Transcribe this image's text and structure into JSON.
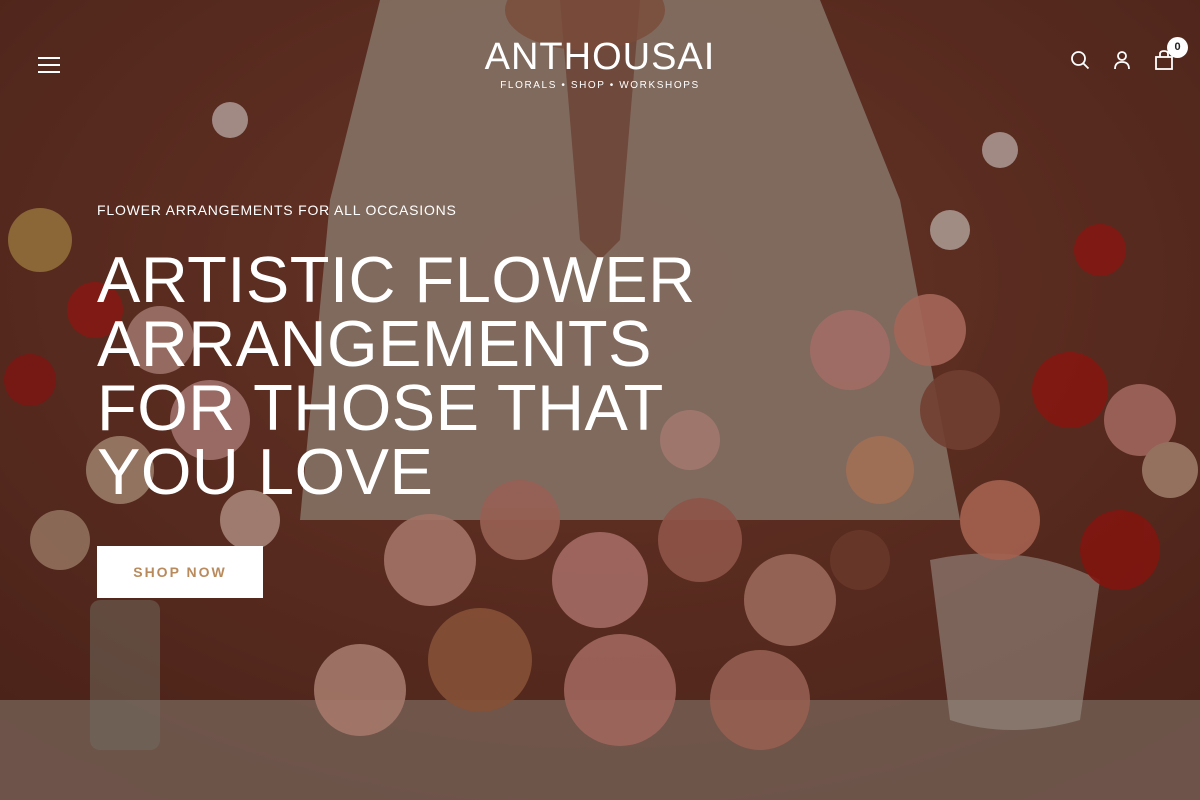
{
  "header": {
    "logo_title": "ANTHOUSAI",
    "logo_subtitle": "FLORALS • SHOP • WORKSHOPS",
    "cart_count": "0",
    "icons": {
      "menu": "hamburger-icon",
      "search": "search-icon",
      "account": "user-icon",
      "cart": "cart-icon"
    }
  },
  "hero": {
    "eyebrow": "FLOWER ARRANGEMENTS FOR ALL OCCASIONS",
    "headline": "ARTISTIC FLOWER ARRANGEMENTS FOR THOSE THAT YOU LOVE",
    "cta_label": "SHOP NOW"
  },
  "colors": {
    "background": "#7a4232",
    "cta_text": "#b98a5c",
    "text": "#ffffff"
  }
}
